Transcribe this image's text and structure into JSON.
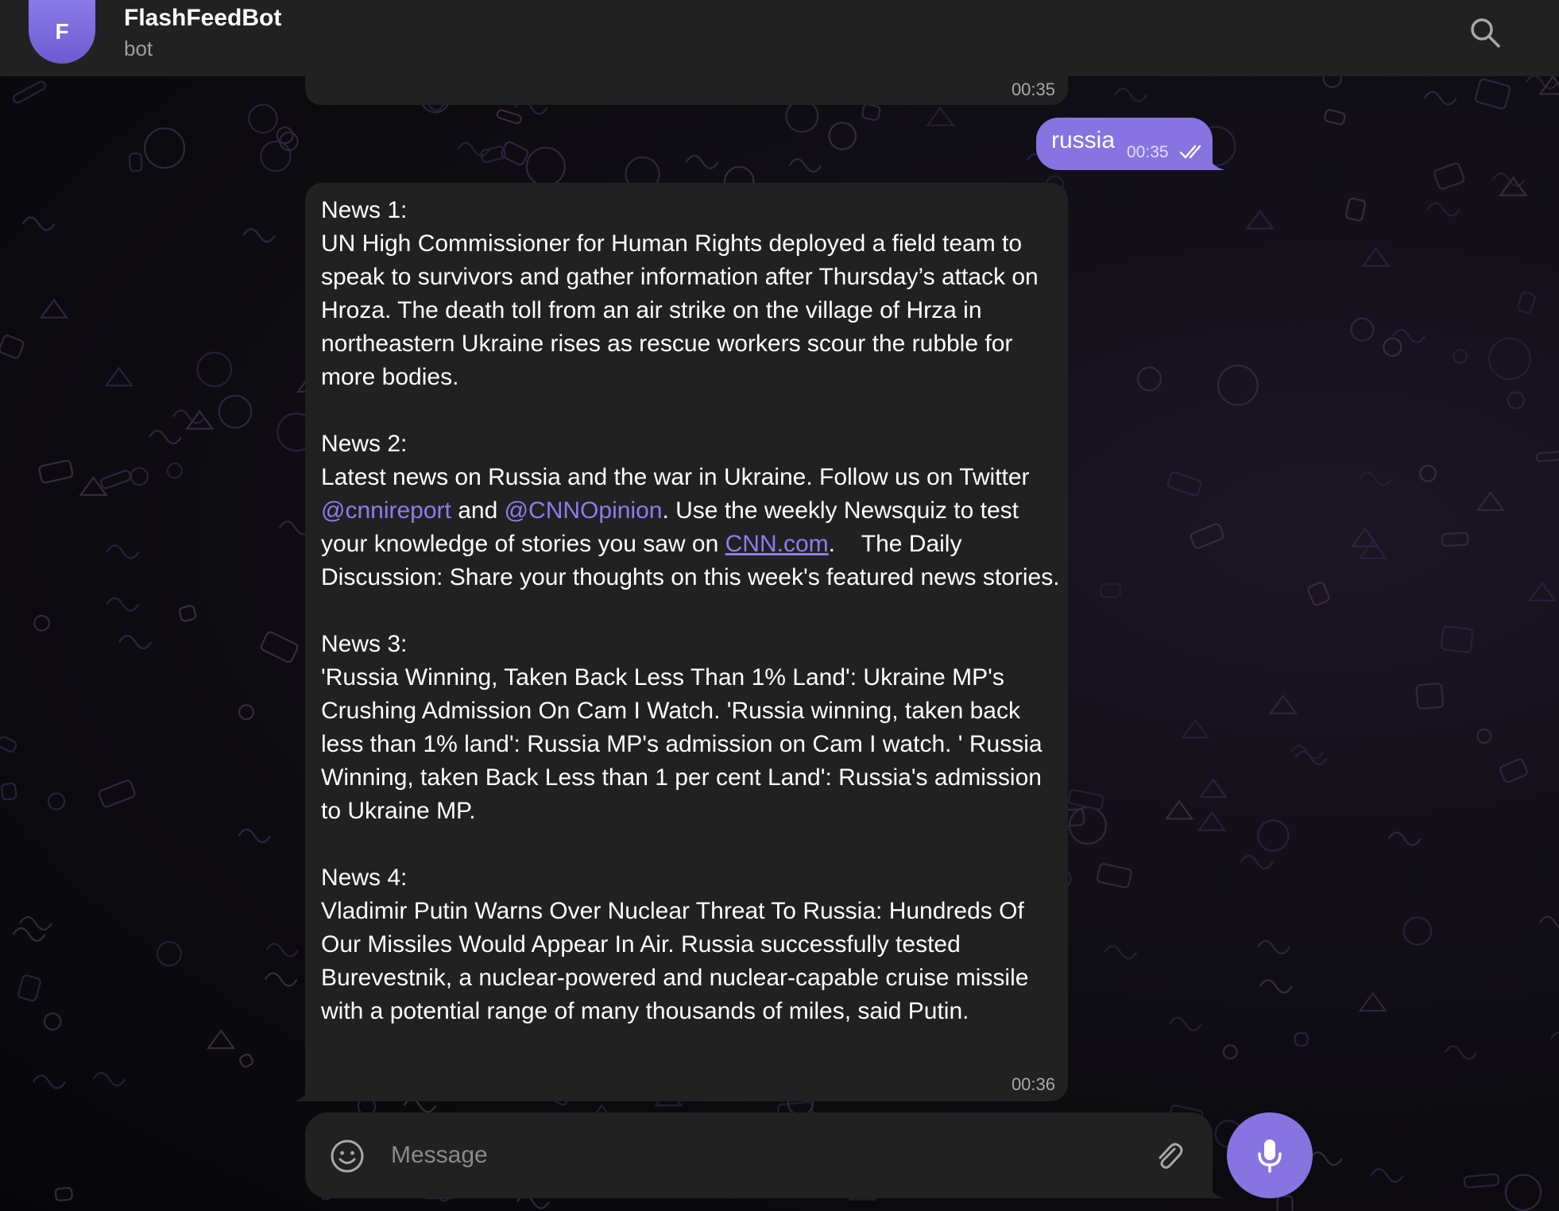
{
  "header": {
    "avatar_letter": "F",
    "title": "FlashFeedBot",
    "subtitle": "bot",
    "search_icon": "search-icon"
  },
  "colors": {
    "accent": "#8774e1",
    "bubble_incoming": "#212121",
    "header_bg": "#212121",
    "link": "#8e7cf0"
  },
  "messages": {
    "previous": {
      "time": "00:35"
    },
    "outgoing": {
      "text": "russia",
      "time": "00:35",
      "status_icon": "double-check-icon"
    },
    "news": {
      "time": "00:36",
      "items": [
        {
          "heading": "News 1:",
          "text": "UN High Commissioner for Human Rights deployed a field team to speak to survivors and gather information after Thursday’s attack on Hroza. The death toll from an air strike on the village of Hrza in northeastern Ukraine rises as rescue workers scour the rubble for more bodies."
        },
        {
          "heading": "News 2:",
          "text_part1": "Latest news on Russia and the war in Ukraine. Follow us on Twitter ",
          "link1": "@cnnireport",
          "text_part2": " and ",
          "link2": "@CNNOpinion",
          "text_part3": ". Use the weekly Newsquiz to test your knowledge of stories you saw on ",
          "link3": "CNN.com",
          "text_part4": ".    The Daily Discussion: Share your thoughts on this week's featured news stories."
        },
        {
          "heading": "News 3:",
          "text": "'Russia Winning, Taken Back Less Than 1% Land': Ukraine MP's Crushing Admission On Cam I Watch. 'Russia winning, taken back less than 1% land': Russia MP's admission on Cam I watch. ' Russia Winning, taken Back Less than 1 per cent Land': Russia's admission to Ukraine MP."
        },
        {
          "heading": "News 4:",
          "text": "Vladimir Putin Warns Over Nuclear Threat To Russia: Hundreds Of Our Missiles Would Appear In Air. Russia successfully tested Burevestnik, a nuclear-powered and nuclear-capable cruise missile with a potential range of many thousands of miles, said Putin."
        }
      ]
    }
  },
  "composer": {
    "placeholder": "Message",
    "emoji_icon": "smile-icon",
    "attach_icon": "paperclip-icon",
    "mic_icon": "microphone-icon"
  }
}
